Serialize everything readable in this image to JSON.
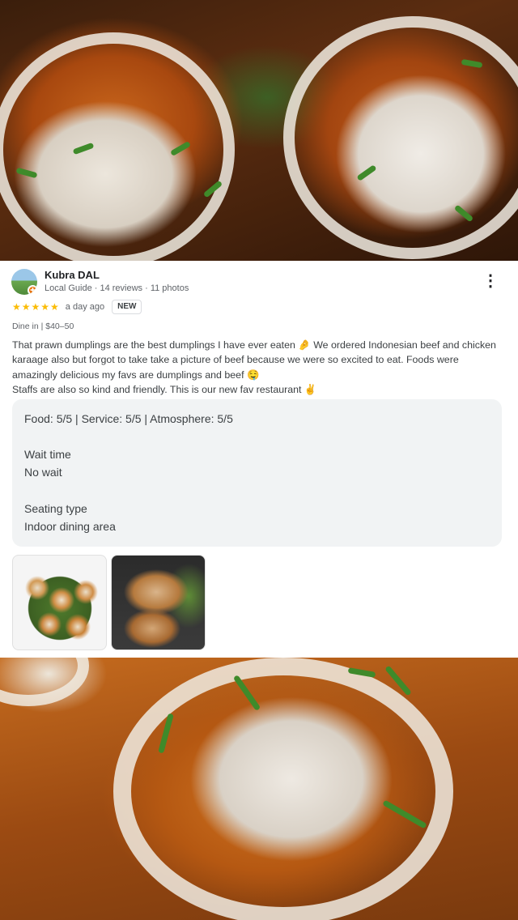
{
  "review": {
    "author_name": "Kubra DAL",
    "author_meta": "Local Guide · 14 reviews · 11 photos",
    "rating_stars": "★★★★★",
    "rating": 5,
    "time_ago": "a day ago",
    "new_badge": "NEW",
    "dine_info": "Dine in  |  $40–50",
    "text_lines": [
      "That prawn dumplings are the best dumplings I have ever eaten 🤌 We ordered Indonesian beef and chicken karaage also but forgot to take take a picture of beef because we were so excited to eat. Foods were amazingly delicious my favs are dumplings and beef 🤤",
      "Staffs are also so kind and friendly. This is our new fav restaurant ✌️"
    ],
    "attributes": {
      "scores": "Food: 5/5  |  Service: 5/5  |  Atmosphere: 5/5",
      "wait_label": "Wait time",
      "wait_value": "No wait",
      "seating_label": "Seating type",
      "seating_value": "Indoor dining area"
    },
    "photos": [
      "dumplings-plate-photo",
      "karaage-plate-photo"
    ],
    "more_icon": "⋮"
  },
  "colors": {
    "star": "#fbbc04",
    "card_bg": "#ffffff",
    "attr_bg": "#f1f3f4",
    "text_primary": "#202124",
    "text_secondary": "#5f6368"
  }
}
